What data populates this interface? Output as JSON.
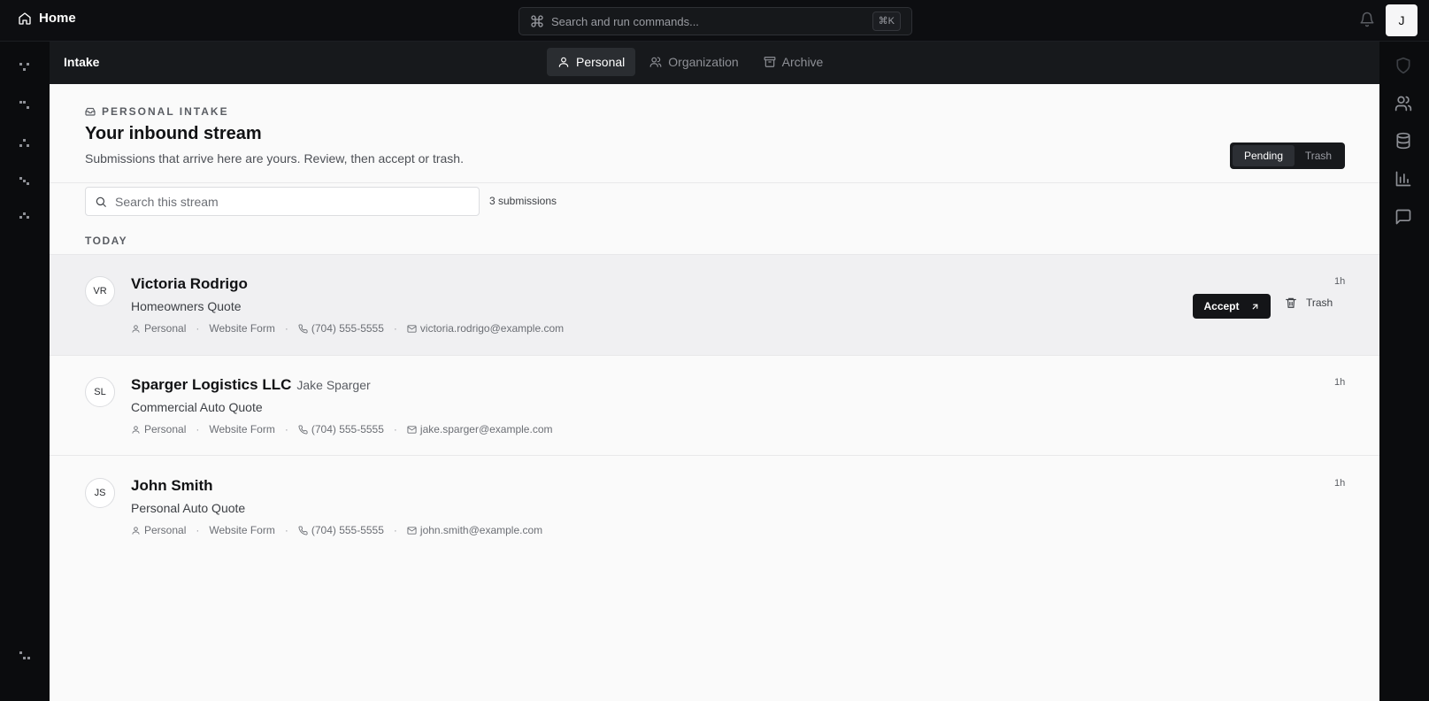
{
  "topbar": {
    "home_label": "Home",
    "search_placeholder": "Search and run commands...",
    "shortcut": "⌘K",
    "user_initial": "J"
  },
  "subheader": {
    "title": "Intake",
    "tabs": [
      {
        "label": "Personal",
        "icon": "user-icon",
        "active": true
      },
      {
        "label": "Organization",
        "icon": "users-icon",
        "active": false
      },
      {
        "label": "Archive",
        "icon": "archive-icon",
        "active": false
      }
    ]
  },
  "page": {
    "eyebrow": "PERSONAL INTAKE",
    "heading": "Your inbound stream",
    "description": "Submissions that arrive here are yours. Review, then accept or trash.",
    "filter": {
      "options": [
        "Pending",
        "Trash"
      ],
      "selected": "Pending"
    },
    "search_placeholder": "Search this stream",
    "count": "3 submissions",
    "group_label": "TODAY"
  },
  "submissions": [
    {
      "initials": "VR",
      "name": "Victoria Rodrigo",
      "contact": "",
      "product": "Homeowners Quote",
      "type": "Personal",
      "source": "Website Form",
      "phone": "(704) 555-5555",
      "email": "victoria.rodrigo@example.com",
      "time": "1h"
    },
    {
      "initials": "SL",
      "name": "Sparger Logistics LLC",
      "contact": "Jake Sparger",
      "product": "Commercial Auto Quote",
      "type": "Personal",
      "source": "Website Form",
      "phone": "(704) 555-5555",
      "email": "jake.sparger@example.com",
      "time": "1h"
    },
    {
      "initials": "JS",
      "name": "John Smith",
      "contact": "",
      "product": "Personal Auto Quote",
      "type": "Personal",
      "source": "Website Form",
      "phone": "(704) 555-5555",
      "email": "john.smith@example.com",
      "time": "1h"
    }
  ],
  "actions": {
    "accept": "Accept",
    "trash": "Trash"
  },
  "right_rail_icons": [
    "shield-icon",
    "users-icon",
    "database-icon",
    "bar-chart-icon",
    "message-icon"
  ],
  "colors": {
    "background_dark": "#0b0c0e",
    "surface": "#fafafa",
    "accent": "#141518",
    "highlight_row": "#f0f0f2"
  }
}
